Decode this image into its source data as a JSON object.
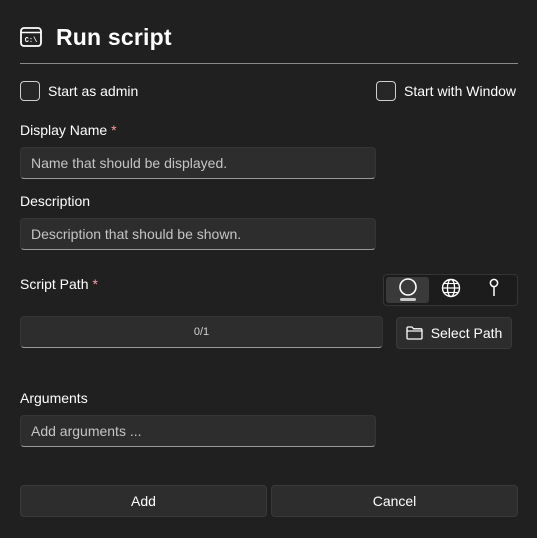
{
  "dialog": {
    "title": "Run script",
    "title_icon": "terminal-icon"
  },
  "options": {
    "start_as_admin": {
      "label": "Start as admin",
      "checked": false
    },
    "start_with_window": {
      "label": "Start with Window",
      "checked": false
    }
  },
  "fields": {
    "display_name": {
      "label": "Display Name",
      "required_mark": "*",
      "value": "",
      "placeholder": "Name that should be displayed."
    },
    "description": {
      "label": "Description",
      "value": "",
      "placeholder": "Description that should be shown."
    },
    "script_path": {
      "label": "Script Path",
      "required_mark": "*",
      "value": "0/1",
      "source_toggle": [
        {
          "icon": "circle-icon",
          "selected": true
        },
        {
          "icon": "globe-icon",
          "selected": false
        },
        {
          "icon": "pin-icon",
          "selected": false
        }
      ],
      "select_button": {
        "label": "Select Path",
        "icon": "folder-icon"
      }
    },
    "arguments": {
      "label": "Arguments",
      "value": "",
      "placeholder": "Add arguments ..."
    }
  },
  "footer": {
    "add_label": "Add",
    "cancel_label": "Cancel"
  },
  "colors": {
    "background": "#202020",
    "control": "#2d2d2d",
    "required": "#ff99a4",
    "text": "#ffffff"
  }
}
